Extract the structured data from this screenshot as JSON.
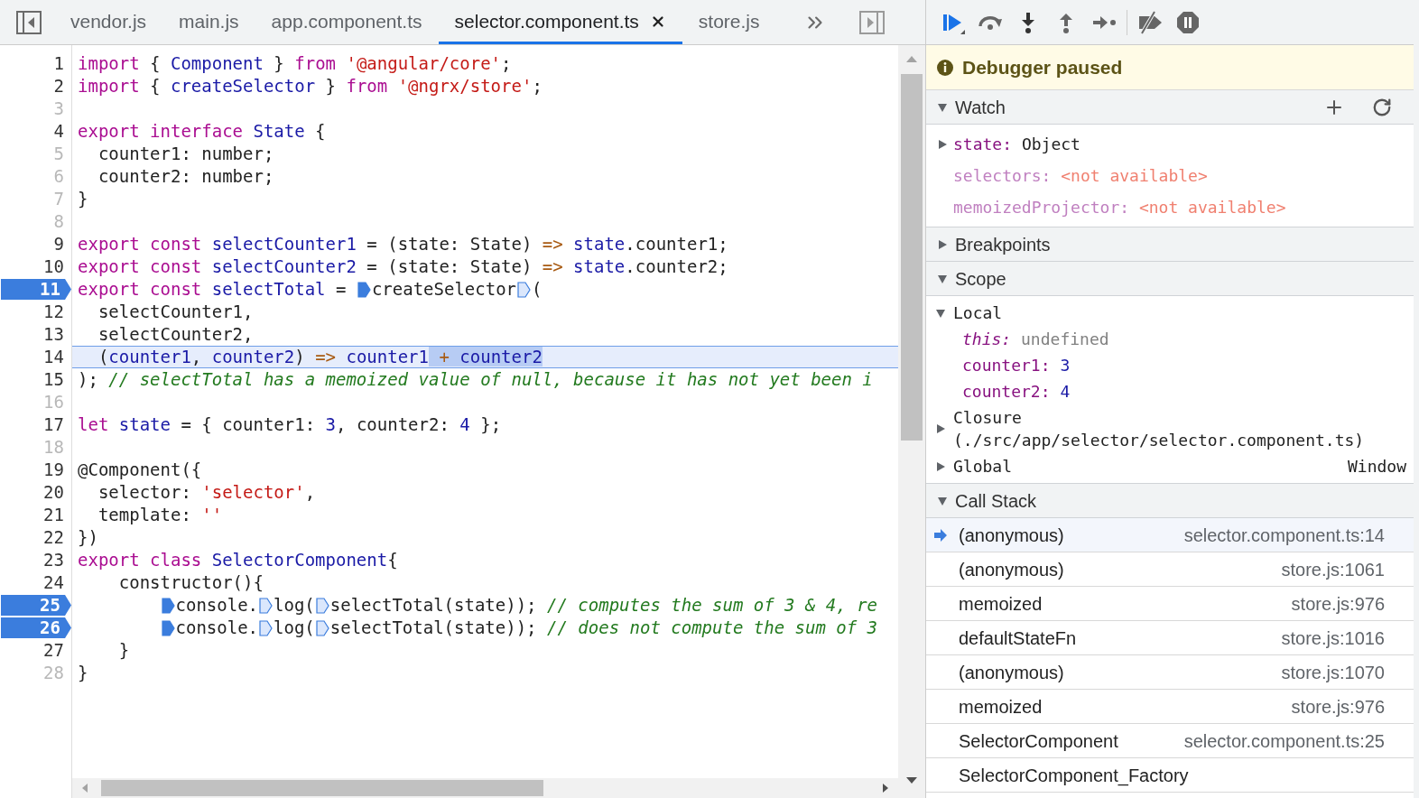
{
  "tabs": [
    {
      "label": "vendor.js",
      "selected": false
    },
    {
      "label": "main.js",
      "selected": false
    },
    {
      "label": "app.component.ts",
      "selected": false
    },
    {
      "label": "selector.component.ts",
      "selected": true
    },
    {
      "label": "store.js",
      "selected": false
    }
  ],
  "code": {
    "lines": [
      {
        "number": "1",
        "breakable": true,
        "breakpoint": false,
        "current": false,
        "tokens": [
          {
            "kind": "keyword",
            "text": "import"
          },
          {
            "kind": "plain",
            "text": " { "
          },
          {
            "kind": "name",
            "text": "Component"
          },
          {
            "kind": "plain",
            "text": " } "
          },
          {
            "kind": "keyword",
            "text": "from "
          },
          {
            "kind": "string",
            "text": "'@angular/core'"
          },
          {
            "kind": "plain",
            "text": ";"
          }
        ]
      },
      {
        "number": "2",
        "breakable": true,
        "breakpoint": false,
        "current": false,
        "tokens": [
          {
            "kind": "keyword",
            "text": "import"
          },
          {
            "kind": "plain",
            "text": " { "
          },
          {
            "kind": "name",
            "text": "createSelector"
          },
          {
            "kind": "plain",
            "text": " } "
          },
          {
            "kind": "keyword",
            "text": "from "
          },
          {
            "kind": "string",
            "text": "'@ngrx/store'"
          },
          {
            "kind": "plain",
            "text": ";"
          }
        ]
      },
      {
        "number": "3",
        "breakable": false,
        "breakpoint": false,
        "current": false
      },
      {
        "number": "4",
        "breakable": true,
        "breakpoint": false,
        "current": false,
        "tokens": [
          {
            "kind": "keyword",
            "text": "export interface "
          },
          {
            "kind": "name",
            "text": "State"
          },
          {
            "kind": "plain",
            "text": " {"
          }
        ]
      },
      {
        "number": "5",
        "breakable": false,
        "breakpoint": false,
        "current": false,
        "tokens": [
          {
            "kind": "plain",
            "text": "  counter1: number;"
          }
        ]
      },
      {
        "number": "6",
        "breakable": false,
        "breakpoint": false,
        "current": false,
        "tokens": [
          {
            "kind": "plain",
            "text": "  counter2: number;"
          }
        ]
      },
      {
        "number": "7",
        "breakable": false,
        "breakpoint": false,
        "current": false,
        "tokens": [
          {
            "kind": "plain",
            "text": "}"
          }
        ]
      },
      {
        "number": "8",
        "breakable": false,
        "breakpoint": false,
        "current": false
      },
      {
        "number": "9",
        "breakable": true,
        "breakpoint": false,
        "current": false,
        "tokens": [
          {
            "kind": "keyword",
            "text": "export const "
          },
          {
            "kind": "name",
            "text": "selectCounter1"
          },
          {
            "kind": "plain",
            "text": " = (state: State) "
          },
          {
            "kind": "operator",
            "text": "=> "
          },
          {
            "kind": "name",
            "text": "state"
          },
          {
            "kind": "plain",
            "text": ".counter1;"
          }
        ]
      },
      {
        "number": "10",
        "breakable": true,
        "breakpoint": false,
        "current": false,
        "tokens": [
          {
            "kind": "keyword",
            "text": "export const "
          },
          {
            "kind": "name",
            "text": "selectCounter2"
          },
          {
            "kind": "plain",
            "text": " = (state: State) "
          },
          {
            "kind": "operator",
            "text": "=> "
          },
          {
            "kind": "name",
            "text": "state"
          },
          {
            "kind": "plain",
            "text": ".counter2;"
          }
        ]
      },
      {
        "number": "11",
        "breakable": true,
        "breakpoint": true,
        "current": false,
        "tokens": [
          {
            "kind": "keyword",
            "text": "export const "
          },
          {
            "kind": "name",
            "text": "selectTotal"
          },
          {
            "kind": "plain",
            "text": " = "
          },
          {
            "kind": "marker",
            "active": true
          },
          {
            "kind": "plain",
            "text": "createSelector"
          },
          {
            "kind": "marker",
            "active": false
          },
          {
            "kind": "plain",
            "text": "("
          }
        ]
      },
      {
        "number": "12",
        "breakable": true,
        "breakpoint": false,
        "current": false,
        "tokens": [
          {
            "kind": "plain",
            "text": "  selectCounter1,"
          }
        ]
      },
      {
        "number": "13",
        "breakable": true,
        "breakpoint": false,
        "current": false,
        "tokens": [
          {
            "kind": "plain",
            "text": "  selectCounter2,"
          }
        ]
      },
      {
        "number": "14",
        "breakable": true,
        "breakpoint": false,
        "current": true,
        "tokens": [
          {
            "kind": "plain",
            "text": "  ("
          },
          {
            "kind": "name",
            "text": "counter1"
          },
          {
            "kind": "plain",
            "text": ", "
          },
          {
            "kind": "name",
            "text": "counter2"
          },
          {
            "kind": "plain",
            "text": ") "
          },
          {
            "kind": "operator",
            "text": "=> "
          },
          {
            "kind": "name",
            "text": "counter1"
          },
          {
            "kind": "operator",
            "text": " + ",
            "highlighted": true
          },
          {
            "kind": "name",
            "text": "counter2",
            "highlighted": true
          }
        ]
      },
      {
        "number": "15",
        "breakable": true,
        "breakpoint": false,
        "current": false,
        "tokens": [
          {
            "kind": "plain",
            "text": "); "
          },
          {
            "kind": "comment",
            "text": "// selectTotal has a memoized value of null, because it has not yet been i"
          }
        ]
      },
      {
        "number": "16",
        "breakable": false,
        "breakpoint": false,
        "current": false
      },
      {
        "number": "17",
        "breakable": true,
        "breakpoint": false,
        "current": false,
        "tokens": [
          {
            "kind": "keyword",
            "text": "let "
          },
          {
            "kind": "name",
            "text": "state"
          },
          {
            "kind": "plain",
            "text": " = { counter1: "
          },
          {
            "kind": "number",
            "text": "3"
          },
          {
            "kind": "plain",
            "text": ", counter2: "
          },
          {
            "kind": "number",
            "text": "4"
          },
          {
            "kind": "plain",
            "text": " };"
          }
        ]
      },
      {
        "number": "18",
        "breakable": false,
        "breakpoint": false,
        "current": false
      },
      {
        "number": "19",
        "breakable": true,
        "breakpoint": false,
        "current": false,
        "tokens": [
          {
            "kind": "plain",
            "text": "@Component({"
          }
        ]
      },
      {
        "number": "20",
        "breakable": true,
        "breakpoint": false,
        "current": false,
        "tokens": [
          {
            "kind": "plain",
            "text": "  selector: "
          },
          {
            "kind": "string",
            "text": "'selector'"
          },
          {
            "kind": "plain",
            "text": ","
          }
        ]
      },
      {
        "number": "21",
        "breakable": true,
        "breakpoint": false,
        "current": false,
        "tokens": [
          {
            "kind": "plain",
            "text": "  template: "
          },
          {
            "kind": "string",
            "text": "''"
          }
        ]
      },
      {
        "number": "22",
        "breakable": true,
        "breakpoint": false,
        "current": false,
        "tokens": [
          {
            "kind": "plain",
            "text": "})"
          }
        ]
      },
      {
        "number": "23",
        "breakable": true,
        "breakpoint": false,
        "current": false,
        "tokens": [
          {
            "kind": "keyword",
            "text": "export class "
          },
          {
            "kind": "name",
            "text": "SelectorComponent"
          },
          {
            "kind": "plain",
            "text": "{"
          }
        ]
      },
      {
        "number": "24",
        "breakable": true,
        "breakpoint": false,
        "current": false,
        "tokens": [
          {
            "kind": "plain",
            "text": "    constructor(){"
          }
        ]
      },
      {
        "number": "25",
        "breakable": true,
        "breakpoint": true,
        "current": false,
        "nested": true,
        "tokens": [
          {
            "kind": "marker",
            "active": true
          },
          {
            "kind": "plain",
            "text": "console."
          },
          {
            "kind": "marker",
            "active": false
          },
          {
            "kind": "plain",
            "text": "log("
          },
          {
            "kind": "marker",
            "active": false
          },
          {
            "kind": "plain",
            "text": "selectTotal(state)); "
          },
          {
            "kind": "comment",
            "text": "// computes the sum of 3 & 4, re"
          }
        ]
      },
      {
        "number": "26",
        "breakable": true,
        "breakpoint": true,
        "current": false,
        "nested": true,
        "tokens": [
          {
            "kind": "marker",
            "active": true
          },
          {
            "kind": "plain",
            "text": "console."
          },
          {
            "kind": "marker",
            "active": false
          },
          {
            "kind": "plain",
            "text": "log("
          },
          {
            "kind": "marker",
            "active": false
          },
          {
            "kind": "plain",
            "text": "selectTotal(state)); "
          },
          {
            "kind": "comment",
            "text": "// does not compute the sum of 3"
          }
        ]
      },
      {
        "number": "27",
        "breakable": true,
        "breakpoint": false,
        "current": false,
        "tokens": [
          {
            "kind": "plain",
            "text": "    }"
          }
        ]
      },
      {
        "number": "28",
        "breakable": false,
        "breakpoint": false,
        "current": false,
        "tokens": [
          {
            "kind": "plain",
            "text": "}"
          }
        ]
      }
    ]
  },
  "debugger": {
    "banner": "Debugger paused",
    "watch": {
      "title": "Watch",
      "expanded": true,
      "items": [
        {
          "name": "state:",
          "value": "Object",
          "expandable": true,
          "available": true
        },
        {
          "name": "selectors:",
          "value": "<not available>",
          "expandable": false,
          "available": false
        },
        {
          "name": "memoizedProjector:",
          "value": "<not available>",
          "expandable": false,
          "available": false
        }
      ]
    },
    "breakpoints": {
      "title": "Breakpoints",
      "expanded": false
    },
    "scope": {
      "title": "Scope",
      "expanded": true,
      "groups": [
        {
          "title": "Local",
          "expanded": true,
          "vars": [
            {
              "name": "this:",
              "value": "undefined",
              "kind": "receiver"
            },
            {
              "name": "counter1:",
              "value": "3",
              "kind": "number"
            },
            {
              "name": "counter2:",
              "value": "4",
              "kind": "number"
            }
          ]
        },
        {
          "title": "Closure",
          "subtitle": "(./src/app/selector/selector.component.ts)",
          "expanded": false
        },
        {
          "title": "Global",
          "value": "Window",
          "expanded": false
        }
      ]
    },
    "call_stack": {
      "title": "Call Stack",
      "expanded": true,
      "frames": [
        {
          "function": "(anonymous)",
          "location": "selector.component.ts:14",
          "selected": true
        },
        {
          "function": "(anonymous)",
          "location": "store.js:1061",
          "selected": false
        },
        {
          "function": "memoized",
          "location": "store.js:976",
          "selected": false
        },
        {
          "function": "defaultStateFn",
          "location": "store.js:1016",
          "selected": false
        },
        {
          "function": "(anonymous)",
          "location": "store.js:1070",
          "selected": false
        },
        {
          "function": "memoized",
          "location": "store.js:976",
          "selected": false
        },
        {
          "function": "SelectorComponent",
          "location": "selector.component.ts:25",
          "selected": false
        },
        {
          "function": "SelectorComponent_Factory",
          "selected": false
        }
      ]
    }
  }
}
